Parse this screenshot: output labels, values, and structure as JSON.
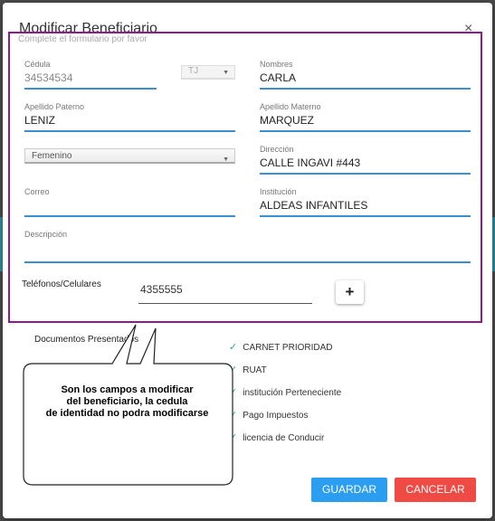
{
  "modal": {
    "title": "Modificar Beneficiario",
    "close_icon": "×",
    "subtitle": "Complete el formulario por favor"
  },
  "form": {
    "cedula": {
      "label": "Cédula",
      "value": "34534534"
    },
    "extension": {
      "value": "TJ"
    },
    "nombres": {
      "label": "Nombres",
      "value": "CARLA"
    },
    "apellido_paterno": {
      "label": "Apellido Paterno",
      "value": "LENIZ"
    },
    "apellido_materno": {
      "label": "Apellido Materno",
      "value": "MARQUEZ"
    },
    "genero": {
      "value": "Femenino"
    },
    "direccion": {
      "label": "Dirección",
      "value": "CALLE INGAVI #443"
    },
    "correo": {
      "label": "Correo",
      "value": ""
    },
    "institucion": {
      "label": "Institución",
      "value": "ALDEAS INFANTILES"
    },
    "descripcion": {
      "label": "Descripción",
      "value": ""
    },
    "telefonos": {
      "label": "Teléfonos/Celulares",
      "value": "4355555",
      "add_icon": "+"
    }
  },
  "documentos": {
    "label": "Documentos Presentados",
    "items": [
      {
        "label": "CARNET PRIORIDAD"
      },
      {
        "label": "RUAT"
      },
      {
        "label": "institución Perteneciente"
      },
      {
        "label": "Pago Impuestos"
      },
      {
        "label": "licencia de Conducir"
      }
    ]
  },
  "callout": {
    "line1": "Son los campos a modificar",
    "line2": "del beneficiario, la cedula",
    "line3": "de identidad no podra modificarse"
  },
  "buttons": {
    "save": "GUARDAR",
    "cancel": "CANCELAR"
  },
  "colors": {
    "frame": "#8e1a8e",
    "underline": "#3a8fd0",
    "save": "#2b9ef2",
    "cancel": "#f04a45",
    "check": "#1aa89a"
  }
}
